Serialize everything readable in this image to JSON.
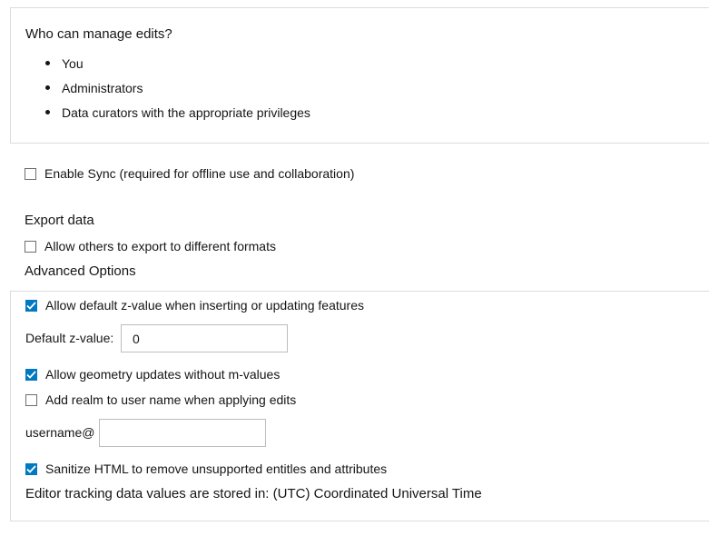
{
  "manage_edits": {
    "title": "Who can manage edits?",
    "items": [
      "You",
      "Administrators",
      "Data curators with the appropriate privileges"
    ]
  },
  "sync": {
    "label": "Enable Sync (required for offline use and collaboration)",
    "checked": false
  },
  "export": {
    "heading": "Export data",
    "label": "Allow others to export to different formats",
    "checked": false
  },
  "advanced": {
    "heading": "Advanced Options",
    "allow_z": {
      "label": "Allow default z-value when inserting or updating features",
      "checked": true
    },
    "z_value": {
      "label": "Default z-value:",
      "value": "0"
    },
    "allow_geom": {
      "label": "Allow geometry updates without m-values",
      "checked": true
    },
    "add_realm": {
      "label": "Add realm to user name when applying edits",
      "checked": false
    },
    "username": {
      "label": "username@",
      "value": ""
    },
    "sanitize": {
      "label": "Sanitize HTML to remove unsupported entitles and attributes",
      "checked": true
    },
    "tracking_note": "Editor tracking data values are stored in: (UTC) Coordinated Universal Time"
  },
  "colors": {
    "checkbox_checked": "#0079c1",
    "border": "#dcdcdc"
  }
}
